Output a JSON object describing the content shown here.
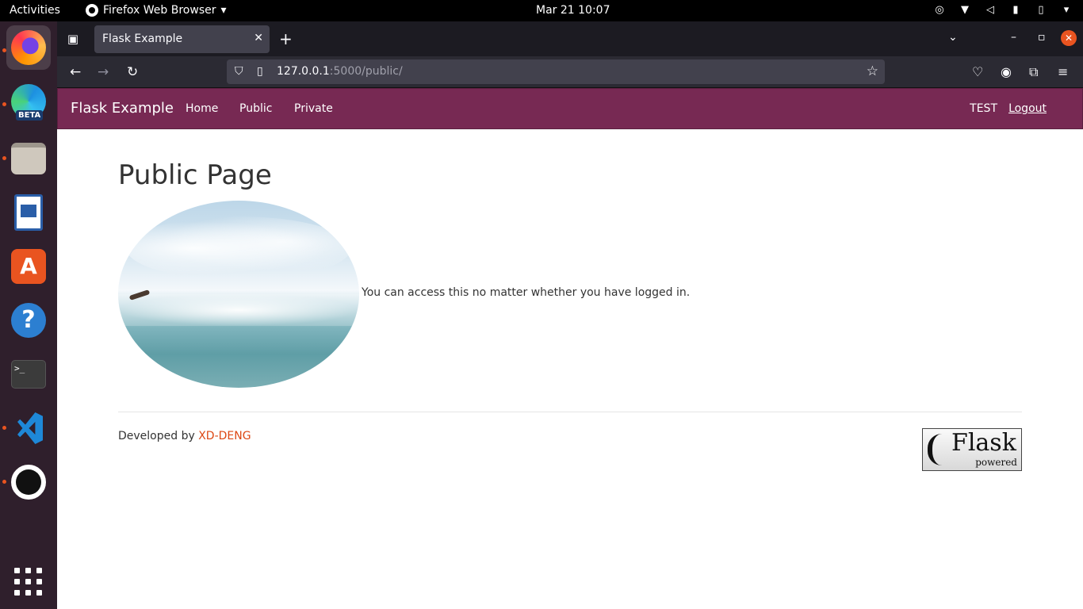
{
  "system_bar": {
    "activities": "Activities",
    "app_name": "Firefox Web Browser",
    "clock": "Mar 21  10:07"
  },
  "dock": {
    "apps": [
      {
        "name": "firefox",
        "icon": "firefox-icon"
      },
      {
        "name": "edge-beta",
        "icon": "edge-beta-icon",
        "badge": "BETA"
      },
      {
        "name": "files",
        "icon": "files-icon"
      },
      {
        "name": "libreoffice-writer",
        "icon": "writer-icon"
      },
      {
        "name": "ubuntu-software",
        "icon": "software-store-icon"
      },
      {
        "name": "help",
        "icon": "help-icon"
      },
      {
        "name": "terminal",
        "icon": "terminal-icon",
        "prompt": ">_"
      },
      {
        "name": "vscode",
        "icon": "vscode-icon"
      },
      {
        "name": "obs-studio",
        "icon": "obs-icon"
      }
    ],
    "show_apps_icon": "app-grid-icon"
  },
  "browser": {
    "tab_title": "Flask Example",
    "url_host": "127.0.0.1",
    "url_rest": ":5000/public/"
  },
  "site": {
    "brand": "Flask Example",
    "nav": [
      "Home",
      "Public",
      "Private"
    ],
    "user": "TEST",
    "logout": "Logout",
    "heading": "Public Page",
    "intro": "You can access this no matter whether you have logged in.",
    "footer_prefix": "Developed by ",
    "footer_link": "XD-DENG",
    "badge_title": "Flask",
    "badge_sub": "powered",
    "colors": {
      "navbar": "#772953",
      "link": "#dd4814"
    }
  }
}
